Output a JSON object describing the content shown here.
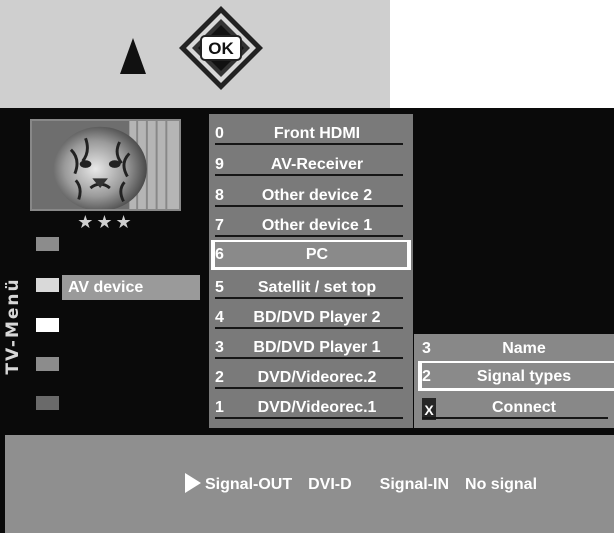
{
  "header": {
    "ok_label": "OK"
  },
  "sidebar": {
    "title": "TV-Menü",
    "stars": "★★★",
    "active_item_label": "AV device"
  },
  "device_list": {
    "items": [
      {
        "num": "0",
        "label": "Front HDMI"
      },
      {
        "num": "9",
        "label": "AV-Receiver"
      },
      {
        "num": "8",
        "label": "Other device 2"
      },
      {
        "num": "7",
        "label": "Other device 1"
      },
      {
        "num": "6",
        "label": "PC"
      },
      {
        "num": "5",
        "label": "Satellit / set top"
      },
      {
        "num": "4",
        "label": "BD/DVD Player 2"
      },
      {
        "num": "3",
        "label": "BD/DVD Player 1"
      },
      {
        "num": "2",
        "label": "DVD/Videorec.2"
      },
      {
        "num": "1",
        "label": "DVD/Videorec.1"
      }
    ],
    "selected": "PC"
  },
  "submenu": {
    "items": [
      {
        "num": "3",
        "label": "Name"
      },
      {
        "num": "2",
        "label": "Signal types"
      },
      {
        "num": "X",
        "label": "Connect"
      }
    ],
    "selected": "Signal types"
  },
  "status": {
    "signal_out_label": "Signal-OUT",
    "signal_out_value": "DVI-D",
    "signal_in_label": "Signal-IN",
    "signal_in_value": "No signal"
  },
  "colors": {
    "menu_gray": "#7a7a7a",
    "highlight": "#ffffff",
    "background": "#0a0a0a",
    "top_panel": "#cfcfcf"
  }
}
